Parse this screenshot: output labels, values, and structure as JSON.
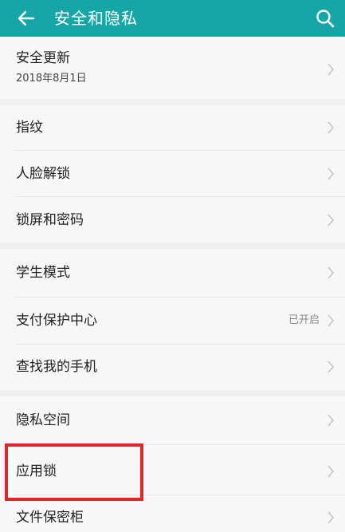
{
  "header": {
    "title": "安全和隐私",
    "back_icon": "arrow-left-icon",
    "search_icon": "search-icon"
  },
  "items": [
    {
      "label": "安全更新",
      "sub": "2018年8月1日"
    },
    {
      "label": "指纹"
    },
    {
      "label": "人脸解锁"
    },
    {
      "label": "锁屏和密码"
    },
    {
      "label": "学生模式"
    },
    {
      "label": "支付保护中心",
      "value": "已开启"
    },
    {
      "label": "查找我的手机"
    },
    {
      "label": "隐私空间"
    },
    {
      "label": "应用锁"
    },
    {
      "label": "文件保密柜"
    }
  ],
  "colors": {
    "accent": "#17a6a6",
    "highlight": "#e1262b"
  }
}
